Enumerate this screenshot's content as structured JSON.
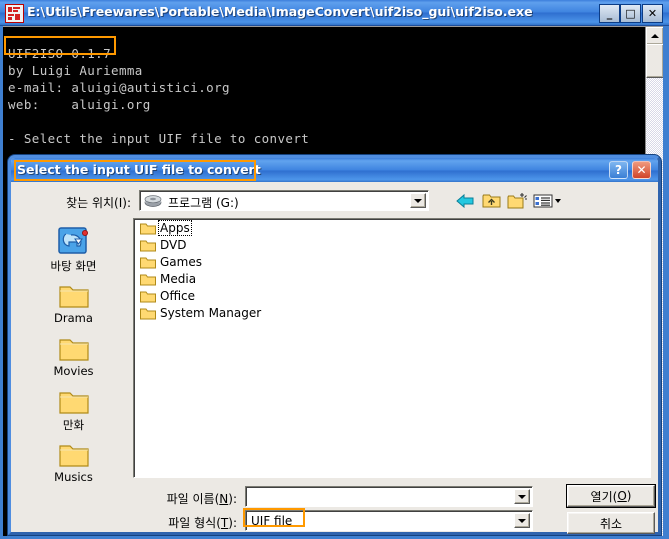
{
  "console_window": {
    "title": "E:\\Utils\\Freewares\\Portable\\Media\\ImageConvert\\uif2iso_gui\\uif2iso.exe",
    "icon": "app-icon",
    "buttons": {
      "minimize": "_",
      "maximize": "□",
      "close": "✕"
    },
    "output": {
      "line_1": "UIF2ISO 0.1.7",
      "line_2": "by Luigi Auriemma",
      "line_3": "e-mail: aluigi@autistici.org",
      "line_4": "web:    aluigi.org",
      "line_5": "",
      "line_6": "- Select the input UIF file to convert",
      "full_text": "UIF2ISO 0.1.7\nby Luigi Auriemma\ne-mail: aluigi@autistici.org\nweb:    aluigi.org\n\n- Select the input UIF file to convert"
    }
  },
  "dialog": {
    "title": "Select the input UIF file to convert",
    "help_button": "?",
    "close_button": "✕",
    "lookin": {
      "label": "찾는 위치(I):",
      "value": "프로그램 (G:)",
      "icon": "drive-icon"
    },
    "toolbar": [
      {
        "name": "back-icon",
        "label": "←"
      },
      {
        "name": "up-folder-icon",
        "label": "↑"
      },
      {
        "name": "new-folder-icon",
        "label": "+"
      },
      {
        "name": "views-icon",
        "label": "▾"
      }
    ],
    "places": [
      {
        "label": "바탕 화면",
        "icon": "desktop-icon"
      },
      {
        "label": "Drama",
        "icon": "folder-icon"
      },
      {
        "label": "Movies",
        "icon": "folder-icon"
      },
      {
        "label": "만화",
        "icon": "folder-icon"
      },
      {
        "label": "Musics",
        "icon": "folder-icon"
      }
    ],
    "files": [
      {
        "name": "Apps",
        "icon": "folder-icon",
        "focused": true
      },
      {
        "name": "DVD",
        "icon": "folder-icon",
        "focused": false
      },
      {
        "name": "Games",
        "icon": "folder-icon",
        "focused": false
      },
      {
        "name": "Media",
        "icon": "folder-icon",
        "focused": false
      },
      {
        "name": "Office",
        "icon": "folder-icon",
        "focused": false
      },
      {
        "name": "System Manager",
        "icon": "folder-icon",
        "focused": false
      }
    ],
    "filename": {
      "label_prefix": "파일 이름(",
      "label_accel": "N",
      "label_suffix": "):",
      "value": "",
      "placeholder": ""
    },
    "filetype": {
      "label_prefix": "파일 형식(",
      "label_accel": "T",
      "label_suffix": "):",
      "value": "UIF file"
    },
    "buttons": {
      "open_prefix": "열기(",
      "open_accel": "O",
      "open_suffix": ")",
      "cancel": "취소"
    }
  },
  "annotations": {
    "highlight_color": "#ff9900",
    "boxes": [
      {
        "target": "console-version-text",
        "label": "UIF2ISO 0.1.7"
      },
      {
        "target": "dialog-title",
        "label": "Select the input UIF file to convert"
      },
      {
        "target": "filetype-value",
        "label": "UIF file"
      }
    ]
  },
  "colors": {
    "titlebar_blue": "#3f84e0",
    "dialog_face": "#ece9e4",
    "console_bg": "#000000",
    "console_fg": "#c8c8c8",
    "folder_yellow": "#ffd972",
    "highlight": "#ff9900"
  }
}
